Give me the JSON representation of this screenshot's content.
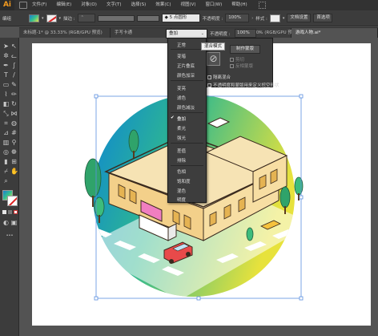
{
  "app": {
    "logo": "Ai"
  },
  "menu": [
    "文件(F)",
    "编辑(E)",
    "对象(O)",
    "文字(T)",
    "选择(S)",
    "效果(C)",
    "视图(V)",
    "窗口(W)",
    "帮助(H)"
  ],
  "control_bar": {
    "object_label": "编组",
    "stroke_label": "描边 :",
    "stroke_dot": "◆",
    "brush_value": "5 点圆形",
    "opacity_label": "不透明度 :",
    "opacity_value": "100%",
    "style_label": "样式 :",
    "doc_settings_label": "文档设置",
    "prefs_label": "首选项"
  },
  "tabs": [
    {
      "label": "未标题-1* @ 33.33% (RGB/GPU 预览)",
      "active": false
    },
    {
      "label": "手写卡通",
      "active": false
    },
    {
      "label": "@ 50% (RGB/GPU 预览)",
      "active": true
    },
    {
      "label": "游戏人物.ai*",
      "active": false
    }
  ],
  "blend_mode": {
    "current": "叠加",
    "chevron": "⌄",
    "opacity_label": "不透明度 :",
    "opacity_value": "100%",
    "arrow": "›"
  },
  "blend_menu": {
    "groups": [
      [
        "正常"
      ],
      [
        "变暗",
        "正片叠底",
        "颜色加深"
      ],
      [
        "变亮",
        "滤色",
        "颜色减淡"
      ],
      [
        "叠加",
        "柔光",
        "强光"
      ],
      [
        "差值",
        "排除"
      ],
      [
        "色相",
        "饱和度",
        "混色",
        "明度"
      ]
    ],
    "selected": "叠加",
    "check": "✔"
  },
  "transparency_panel": {
    "tooltip": "混合模式",
    "make_mask": "制作蒙版",
    "no_sign": "⊘",
    "clip_label": "剪切",
    "invert_label": "反相蒙版",
    "isolate_label": "隔离混合",
    "knockout_label": "挖空组",
    "opacity_mask_label": "不透明度和蒙版用来定义挖空形状"
  },
  "colors": {
    "circle_gradient": [
      "#0d86d4",
      "#2fb88f",
      "#e7e23c"
    ],
    "accent": "#f29a1f"
  },
  "tool_icons": [
    "selection-arrow-icon",
    "direct-selection-icon",
    "magic-wand-icon",
    "lasso-icon",
    "pen-icon",
    "curvature-icon",
    "type-icon",
    "line-icon",
    "rectangle-icon",
    "paintbrush-icon",
    "shaper-icon",
    "pencil-icon",
    "eraser-icon",
    "rotate-icon",
    "scale-icon",
    "width-icon",
    "free-transform-icon",
    "shape-builder-icon",
    "perspective-icon",
    "mesh-icon",
    "gradient-icon",
    "eyedropper-icon",
    "blend-icon",
    "symbol-sprayer-icon",
    "graph-icon",
    "artboard-icon",
    "slice-icon",
    "hand-icon",
    "zoom-icon"
  ],
  "toolbar_extra": {
    "more_tools": "•••"
  }
}
